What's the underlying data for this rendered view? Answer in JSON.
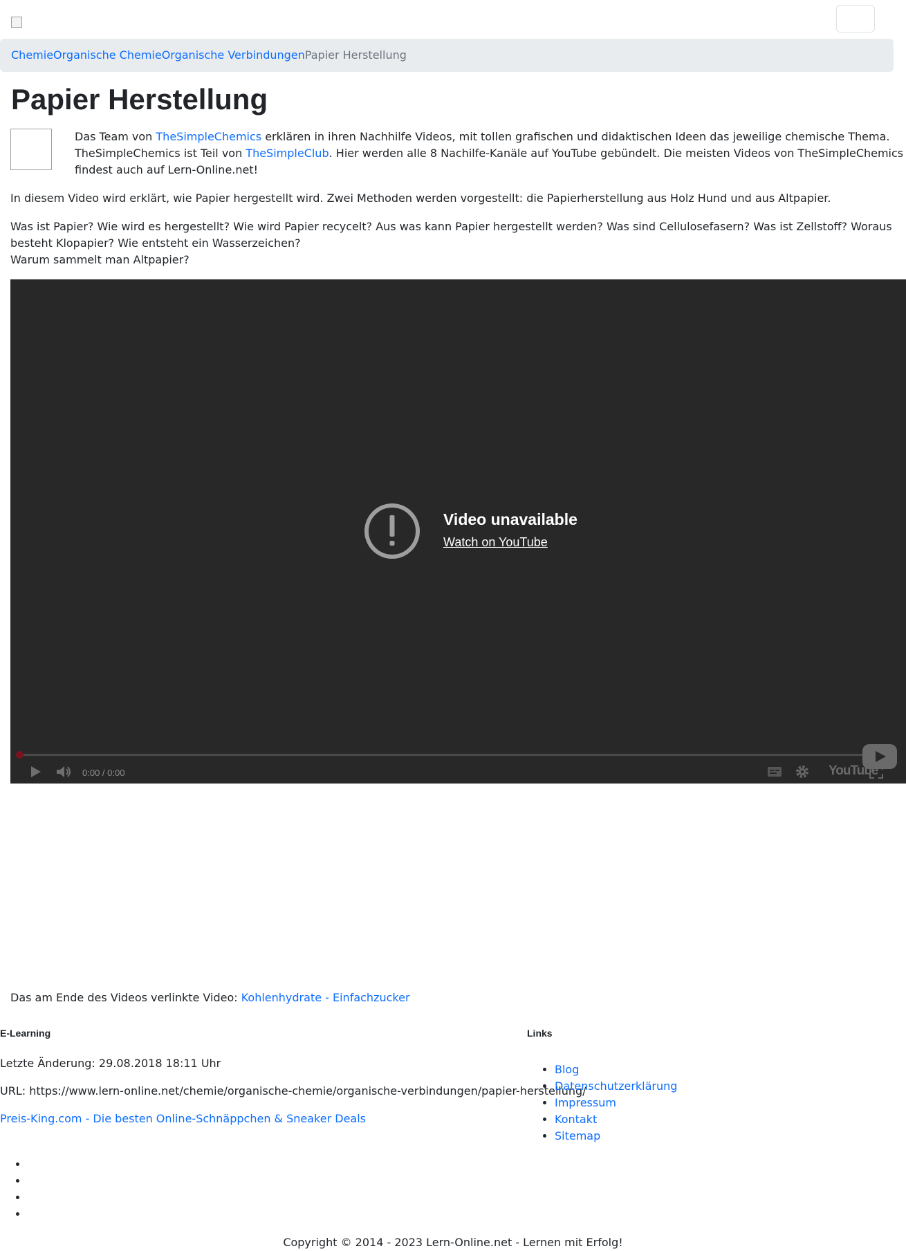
{
  "breadcrumb": {
    "items": [
      "Chemie",
      "Organische Chemie",
      "Organische Verbindungen"
    ],
    "current": "Papier Herstellung"
  },
  "title": "Papier Herstellung",
  "intro": {
    "t1": "Das Team von ",
    "link1": "TheSimpleChemics",
    "t2": " erklären in ihren Nachhilfe Videos, mit tollen grafischen und didaktischen Ideen das jeweilige chemische Thema. TheSimpleChemics ist Teil von ",
    "link2": "TheSimpleClub",
    "t3": ". Hier werden alle 8 Nachilfe-Kanäle auf YouTube gebündelt. Die meisten Videos von TheSimpleChemics findest auch auf Lern-Online.net!"
  },
  "description": {
    "p1": "In diesem Video wird erklärt, wie Papier hergestellt wird. Zwei Methoden werden vorgestellt: die Papierherstellung aus Holz Hund und aus Altpapier.",
    "p2_line1": "Was ist Papier? Wie wird es hergestellt? Wie wird Papier recycelt? Aus was kann Papier hergestellt werden? Was sind Cellulosefasern? Was ist Zellstoff? Woraus besteht Klopapier? Wie entsteht ein Wasserzeichen?",
    "p2_line2": "Warum sammelt man Altpapier?"
  },
  "video": {
    "unavailable_title": "Video unavailable",
    "watch_link": "Watch on YouTube",
    "time": "0:00 / 0:00",
    "brand": "YouTube",
    "progress": 0
  },
  "linked_video": {
    "label": "Das am Ende des Videos verlinkte Video: ",
    "link": "Kohlenhydrate - Einfachzucker"
  },
  "footer": {
    "left_title": "E-Learning",
    "last_change": "Letzte Änderung: 29.08.2018 18:11 Uhr",
    "url": "URL: https://www.lern-online.net/chemie/organische-chemie/organische-verbindungen/papier-herstellung/",
    "partner_link": "Preis-King.com - Die besten Online-Schnäppchen & Sneaker Deals",
    "right_title": "Links",
    "links": [
      "Blog",
      "Datenschutzerklärung",
      "Impressum",
      "Kontakt",
      "Sitemap"
    ],
    "copyright": "Copyright © 2014 - 2023 Lern-Online.net - Lernen mit Erfolg!"
  }
}
